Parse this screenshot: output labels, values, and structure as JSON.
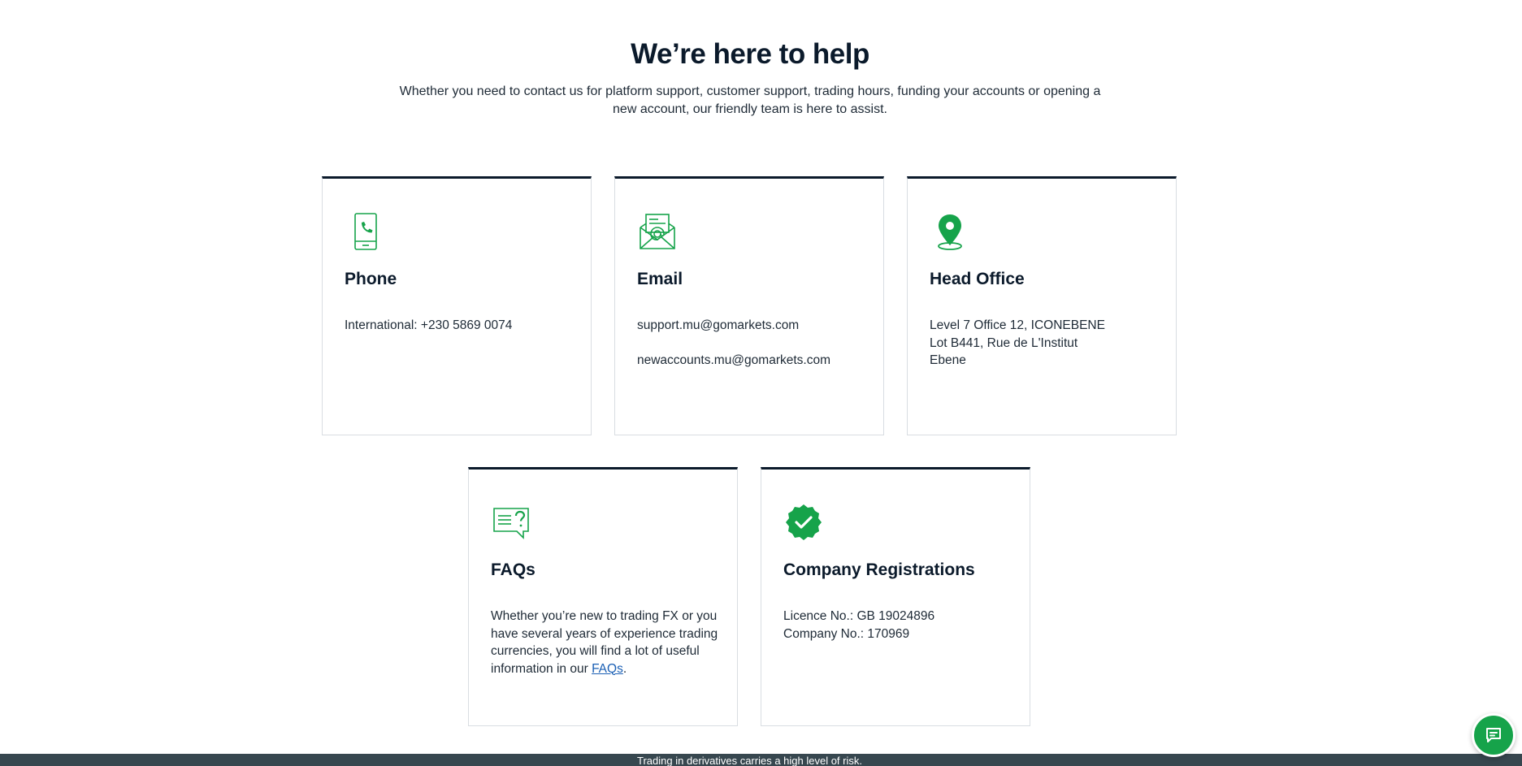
{
  "header": {
    "title": "We’re here to help",
    "intro": "Whether you need to contact us for platform support, customer support, trading hours, funding your accounts or opening a new account, our friendly team is here to assist."
  },
  "cards": {
    "phone": {
      "icon": "phone-icon",
      "title": "Phone",
      "line1": "International: +230 5869 0074"
    },
    "email": {
      "icon": "email-icon",
      "title": "Email",
      "support": "support.mu@gomarkets.com",
      "newaccounts": "newaccounts.mu@gomarkets.com"
    },
    "office": {
      "icon": "location-pin-icon",
      "title": "Head Office",
      "line1": "Level 7 Office 12, ICONEBENE",
      "line2": "Lot B441, Rue de L'Institut",
      "line3": "Ebene"
    },
    "faqs": {
      "icon": "faq-chat-icon",
      "title": "FAQs",
      "text": "Whether you’re new to trading FX or you have several years of experience trading currencies, you will find a lot of useful information in our ",
      "link": "FAQs",
      "end": "."
    },
    "registrations": {
      "icon": "verified-badge-icon",
      "title": "Company Registrations",
      "licence": "Licence No.: GB 19024896",
      "company": "Company No.: 170969"
    }
  },
  "footer": {
    "risk": "Trading in derivatives carries a high level of risk."
  },
  "chat": {
    "icon": "chat-icon"
  },
  "colors": {
    "accent": "#16a34a",
    "text": "#0b1a2b",
    "card_border_top": "#0b1a2b",
    "footer_bg": "#37474f",
    "link": "#1a5fb4"
  }
}
